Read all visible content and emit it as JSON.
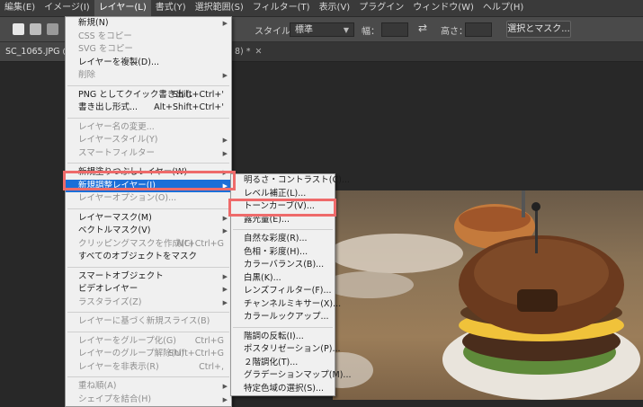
{
  "menubar": {
    "items": [
      "編集(E)",
      "イメージ(I)",
      "レイヤー(L)",
      "書式(Y)",
      "選択範囲(S)",
      "フィルター(T)",
      "表示(V)",
      "プラグイン",
      "ウィンドウ(W)",
      "ヘルプ(H)"
    ]
  },
  "options": {
    "style_label": "スタイル：",
    "style_value": "標準",
    "width_label": "幅：",
    "height_label": "高さ：",
    "select_mask_button": "選択とマスク..."
  },
  "tabs": {
    "left": "SC_1065.JPG @ 33.",
    "right": "8) *"
  },
  "layer_menu": {
    "items": [
      {
        "label": "新規(N)",
        "shortcut": "",
        "submenu": true,
        "disabled": false
      },
      {
        "label": "CSS をコピー",
        "shortcut": "",
        "submenu": false,
        "disabled": true
      },
      {
        "label": "SVG をコピー",
        "shortcut": "",
        "submenu": false,
        "disabled": true
      },
      {
        "label": "レイヤーを複製(D)...",
        "shortcut": "",
        "submenu": false,
        "disabled": false
      },
      {
        "label": "削除",
        "shortcut": "",
        "submenu": true,
        "disabled": true
      },
      {
        "sep": true
      },
      {
        "label": "PNG としてクイック書き出し",
        "shortcut": "Shift+Ctrl+'",
        "submenu": false,
        "disabled": false
      },
      {
        "label": "書き出し形式...",
        "shortcut": "Alt+Shift+Ctrl+'",
        "submenu": false,
        "disabled": false
      },
      {
        "sep": true
      },
      {
        "label": "レイヤー名の変更...",
        "shortcut": "",
        "submenu": false,
        "disabled": true
      },
      {
        "label": "レイヤースタイル(Y)",
        "shortcut": "",
        "submenu": true,
        "disabled": true
      },
      {
        "label": "スマートフィルター",
        "shortcut": "",
        "submenu": true,
        "disabled": true
      },
      {
        "sep": true
      },
      {
        "label": "新規塗りつぶしレイヤー(W)",
        "shortcut": "",
        "submenu": true,
        "disabled": false
      },
      {
        "label": "新規調整レイヤー(J)",
        "shortcut": "",
        "submenu": true,
        "disabled": false,
        "highlight": true
      },
      {
        "label": "レイヤーオプション(O)...",
        "shortcut": "",
        "submenu": false,
        "disabled": true
      },
      {
        "sep": true
      },
      {
        "label": "レイヤーマスク(M)",
        "shortcut": "",
        "submenu": true,
        "disabled": false
      },
      {
        "label": "ベクトルマスク(V)",
        "shortcut": "",
        "submenu": true,
        "disabled": false
      },
      {
        "label": "クリッピングマスクを作成(C)",
        "shortcut": "Alt+Ctrl+G",
        "submenu": false,
        "disabled": true
      },
      {
        "label": "すべてのオブジェクトをマスク",
        "shortcut": "",
        "submenu": false,
        "disabled": false
      },
      {
        "sep": true
      },
      {
        "label": "スマートオブジェクト",
        "shortcut": "",
        "submenu": true,
        "disabled": false
      },
      {
        "label": "ビデオレイヤー",
        "shortcut": "",
        "submenu": true,
        "disabled": false
      },
      {
        "label": "ラスタライズ(Z)",
        "shortcut": "",
        "submenu": true,
        "disabled": true
      },
      {
        "sep": true
      },
      {
        "label": "レイヤーに基づく新規スライス(B)",
        "shortcut": "",
        "submenu": false,
        "disabled": true
      },
      {
        "sep": true
      },
      {
        "label": "レイヤーをグループ化(G)",
        "shortcut": "Ctrl+G",
        "submenu": false,
        "disabled": true
      },
      {
        "label": "レイヤーのグループ解除(U)",
        "shortcut": "Shift+Ctrl+G",
        "submenu": false,
        "disabled": true
      },
      {
        "label": "レイヤーを非表示(R)",
        "shortcut": "Ctrl+,",
        "submenu": false,
        "disabled": true
      },
      {
        "sep": true
      },
      {
        "label": "重ね順(A)",
        "shortcut": "",
        "submenu": true,
        "disabled": true
      },
      {
        "label": "シェイプを結合(H)",
        "shortcut": "",
        "submenu": true,
        "disabled": true
      }
    ]
  },
  "adjust_menu": {
    "items": [
      {
        "label": "明るさ・コントラスト(C)..."
      },
      {
        "label": "レベル補正(L)..."
      },
      {
        "label": "トーンカーブ(V)...",
        "boxed": true
      },
      {
        "label": "露光量(E)..."
      },
      {
        "sep": true
      },
      {
        "label": "自然な彩度(R)..."
      },
      {
        "label": "色相・彩度(H)..."
      },
      {
        "label": "カラーバランス(B)..."
      },
      {
        "label": "白黒(K)..."
      },
      {
        "label": "レンズフィルター(F)..."
      },
      {
        "label": "チャンネルミキサー(X)..."
      },
      {
        "label": "カラールックアップ..."
      },
      {
        "sep": true
      },
      {
        "label": "階調の反転(I)..."
      },
      {
        "label": "ポスタリゼーション(P)..."
      },
      {
        "label": "２階調化(T)..."
      },
      {
        "label": "グラデーションマップ(M)..."
      },
      {
        "label": "特定色域の選択(S)..."
      }
    ]
  },
  "colors": {
    "highlight": "#1c6fd8",
    "annotation": "#ee6a6a"
  }
}
